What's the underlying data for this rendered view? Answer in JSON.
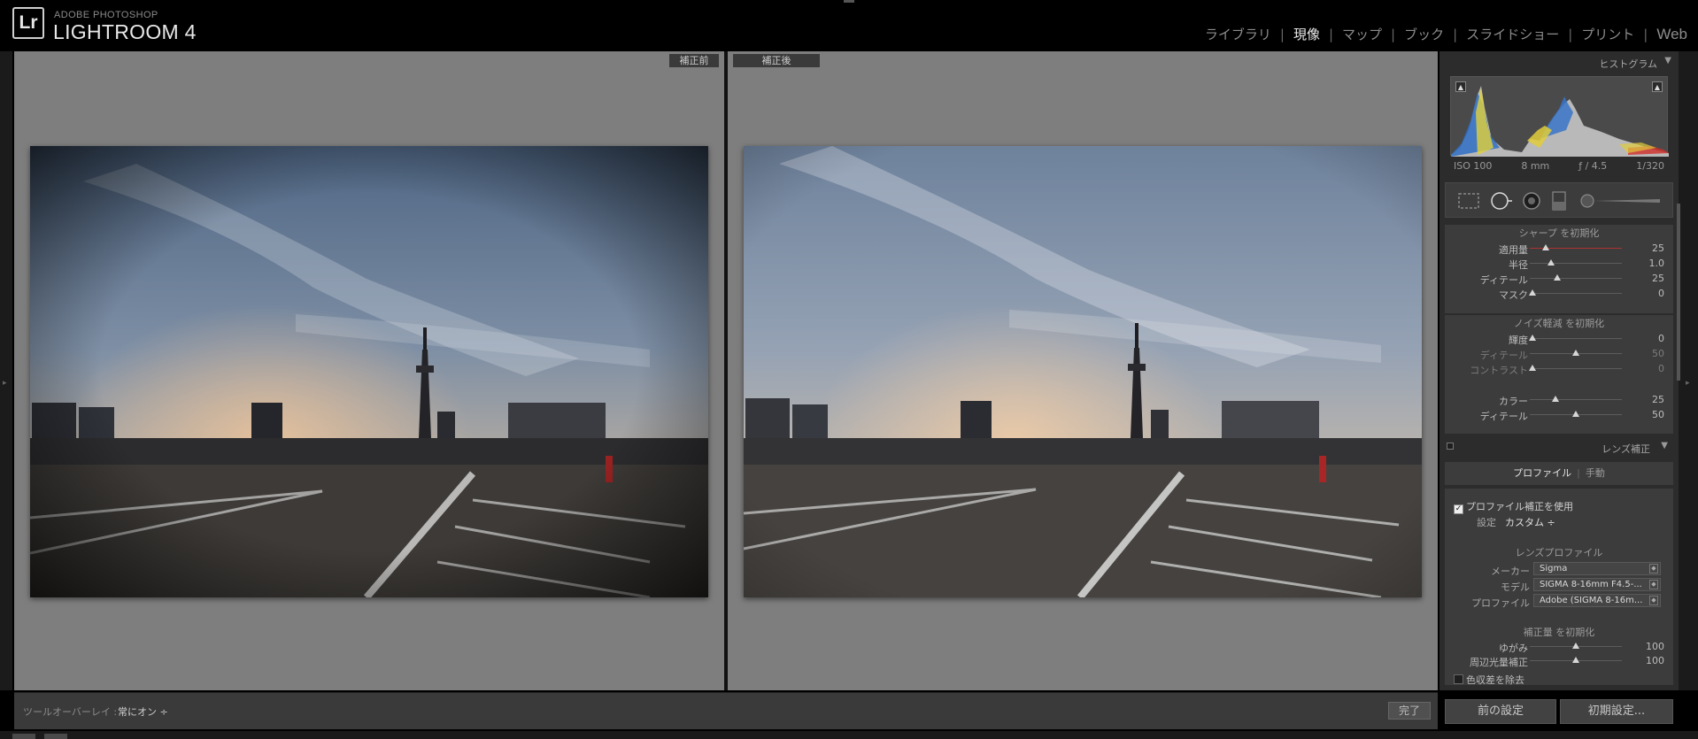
{
  "app": {
    "logo": "Lr",
    "brand_sub": "ADOBE PHOTOSHOP",
    "brand_main": "LIGHTROOM 4"
  },
  "modules": [
    {
      "label": "ライブラリ",
      "active": false
    },
    {
      "label": "現像",
      "active": true
    },
    {
      "label": "マップ",
      "active": false
    },
    {
      "label": "ブック",
      "active": false
    },
    {
      "label": "スライドショー",
      "active": false
    },
    {
      "label": "プリント",
      "active": false
    },
    {
      "label": "Web",
      "active": false
    }
  ],
  "viewer": {
    "before_label": "補正前",
    "after_label": "補正後"
  },
  "toolbar": {
    "overlay_label": "ツールオーバーレイ :",
    "overlay_value": "常にオン ÷",
    "done_label": "完了"
  },
  "histogram": {
    "title": "ヒストグラム",
    "iso": "ISO 100",
    "focal": "8 mm",
    "aperture": "ƒ / 4.5",
    "shutter": "1/320"
  },
  "sharpen": {
    "title": "シャープ を初期化",
    "rows": [
      {
        "label": "適用量",
        "value": "25",
        "pos": 0.17,
        "dim": false
      },
      {
        "label": "半径",
        "value": "1.0",
        "pos": 0.23,
        "dim": false
      },
      {
        "label": "ディテール",
        "value": "25",
        "pos": 0.3,
        "dim": false
      },
      {
        "label": "マスク",
        "value": "0",
        "pos": 0.03,
        "dim": false
      }
    ]
  },
  "noise": {
    "title": "ノイズ軽減 を初期化",
    "rows": [
      {
        "label": "輝度",
        "value": "0",
        "pos": 0.03,
        "dim": false
      },
      {
        "label": "ディテール",
        "value": "50",
        "pos": 0.5,
        "dim": true
      },
      {
        "label": "コントラスト",
        "value": "0",
        "pos": 0.03,
        "dim": true
      },
      {
        "label": "カラー",
        "value": "25",
        "pos": 0.28,
        "dim": false
      },
      {
        "label": "ディテール",
        "value": "50",
        "pos": 0.5,
        "dim": false
      }
    ]
  },
  "lens": {
    "title": "レンズ補正",
    "tab_profile": "プロファイル",
    "tab_manual": "手動",
    "use_profile": "プロファイル補正を使用",
    "setting_label": "設定",
    "setting_value": "カスタム ÷",
    "profile_title": "レンズプロファイル",
    "maker_label": "メーカー",
    "maker_value": "Sigma",
    "model_label": "モデル",
    "model_value": "SIGMA 8-16mm F4.5-...",
    "profile_label": "プロファイル",
    "profile_value": "Adobe (SIGMA 8-16m...",
    "amount_title": "補正量 を初期化",
    "distortion_label": "ゆがみ",
    "distortion_value": "100",
    "vignette_label": "周辺光量補正",
    "vignette_value": "100",
    "chroma_label": "色収差を除去"
  },
  "buttons": {
    "previous": "前の設定",
    "reset": "初期設定..."
  },
  "colors": {
    "panel_bg": "#3c3c3c",
    "viewer_bg": "#7e7e7e",
    "active_module": "#ededed"
  }
}
